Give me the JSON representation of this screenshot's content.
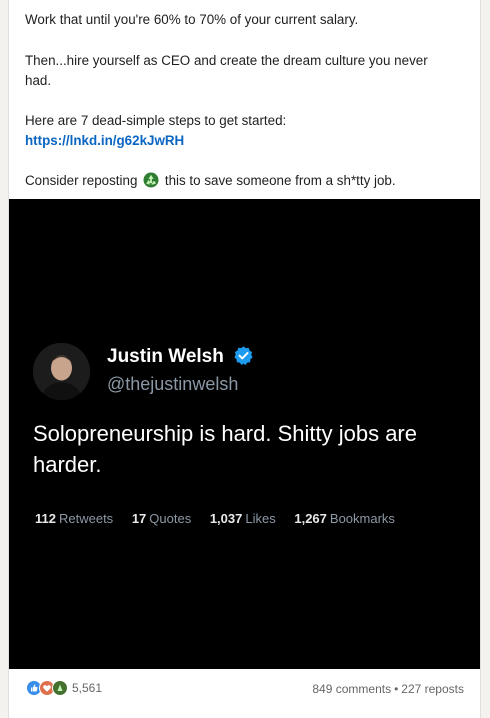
{
  "post": {
    "line1": "Work that until you're 60% to 70% of your current salary.",
    "line2": "Then...hire yourself as CEO and create the dream culture you never had.",
    "line3": "Here are 7 dead-simple steps to get started:",
    "link": "https://lnkd.in/g62kJwRH",
    "line5_before": "Consider reposting",
    "line5_after": "this to save someone from a sh*tty job.",
    "emoji_icon": "recycle-icon"
  },
  "tweet": {
    "name": "Justin Welsh",
    "handle": "@thejustinwelsh",
    "text": "Solopreneurship is hard. Shitty jobs are harder.",
    "stats": [
      {
        "value": "112",
        "label": "Retweets"
      },
      {
        "value": "17",
        "label": "Quotes"
      },
      {
        "value": "1,037",
        "label": "Likes"
      },
      {
        "value": "1,267",
        "label": "Bookmarks"
      }
    ],
    "verified_color": "#1d9bf0"
  },
  "social": {
    "reaction_count": "5,561",
    "comments": "849 comments",
    "reposts": "227 reposts",
    "reaction_icons": [
      "like-icon",
      "love-icon",
      "support-icon"
    ]
  },
  "colors": {
    "link": "#0a66c2",
    "media_bg": "#000000"
  }
}
